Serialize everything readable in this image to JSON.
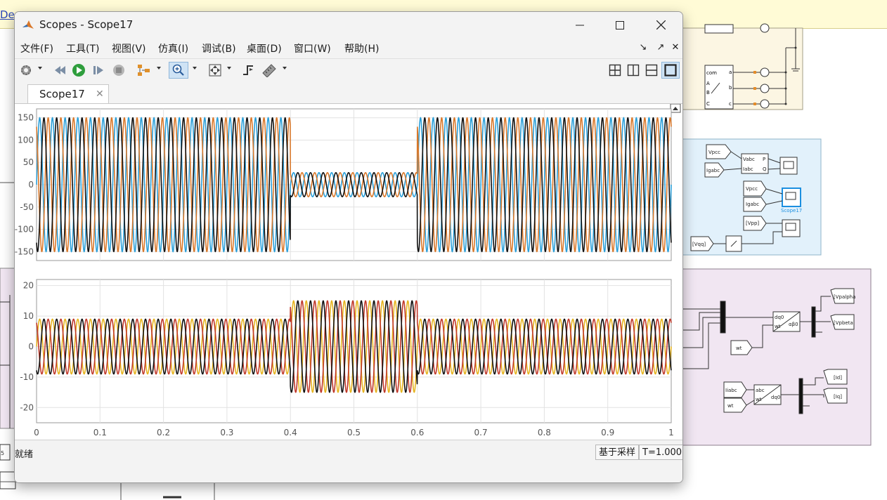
{
  "background": {
    "link_text": "De",
    "scope_block_label": "Scope17",
    "labels": {
      "vpcc1": "Vpcc",
      "igabc1": "Igabc",
      "vabc": "Vabc",
      "iabc": "Iabc",
      "p": "P",
      "q": "Q",
      "vpcc2": "Vpcc",
      "igabc2": "Igabc",
      "vpp": "[Vpp]",
      "vqq": "[Vqq]",
      "vpalpha": "[Vpalpha",
      "vpbeta": "[Vpbeta",
      "wt1": "wt",
      "dq0": "dq0",
      "wt2": "wt",
      "ab0": "αβ0",
      "id": "[Id]",
      "iq": "[Iq]",
      "iiabc": "Iiabc",
      "wt3": "wt",
      "abc": "abc",
      "wt4": "wt",
      "dq02": "dq0",
      "com": "com",
      "a_in": "A",
      "b_in": "B",
      "c_in": "C",
      "a_out": "a",
      "b_out": "b",
      "c_out": "c",
      "side5": "5"
    }
  },
  "window": {
    "title": "Scopes - Scope17",
    "menus": [
      "文件(F)",
      "工具(T)",
      "视图(V)",
      "仿真(I)",
      "调试(B)",
      "桌面(D)",
      "窗口(W)",
      "帮助(H)"
    ],
    "tab_label": "Scope17",
    "status": "就绪",
    "sample_mode": "基于采样",
    "time_readout": "T=1.000"
  },
  "colors": {
    "black": "#111111",
    "orange": "#d9782a",
    "blue": "#2b9fd8",
    "yellow": "#e6b420",
    "dark_orange": "#c0392b"
  },
  "chart_data": [
    {
      "type": "line",
      "title": "",
      "xlim": [
        0,
        1
      ],
      "ylim": [
        -170,
        170
      ],
      "yticks": [
        -150,
        -100,
        -50,
        0,
        50,
        100,
        150
      ],
      "xticks": [],
      "grid": true,
      "series": [
        {
          "color": "blue",
          "phase": 0,
          "amp_segments": [
            [
              0,
              0.4,
              150
            ],
            [
              0.4,
              0.6,
              27
            ],
            [
              0.6,
              1,
              150
            ]
          ]
        },
        {
          "color": "orange",
          "phase": 120,
          "amp_segments": [
            [
              0,
              0.4,
              150
            ],
            [
              0.4,
              0.6,
              27
            ],
            [
              0.6,
              1,
              150
            ]
          ]
        },
        {
          "color": "black",
          "phase": 240,
          "amp_segments": [
            [
              0,
              0.4,
              150
            ],
            [
              0.4,
              0.6,
              27
            ],
            [
              0.6,
              1,
              150
            ]
          ]
        }
      ],
      "frequency_hz": 50
    },
    {
      "type": "line",
      "title": "",
      "xlim": [
        0,
        1
      ],
      "ylim": [
        -25,
        22
      ],
      "yticks": [
        -20,
        -10,
        0,
        10,
        20
      ],
      "xticks": [
        0,
        0.1,
        0.2,
        0.3,
        0.4,
        0.5,
        0.6,
        0.7,
        0.8,
        0.9,
        1
      ],
      "grid": true,
      "series": [
        {
          "color": "yellow",
          "phase": 0,
          "amp_segments": [
            [
              0,
              0.4,
              9
            ],
            [
              0.4,
              0.6,
              15
            ],
            [
              0.6,
              1,
              9
            ]
          ]
        },
        {
          "color": "dark_orange",
          "phase": 120,
          "amp_segments": [
            [
              0,
              0.4,
              9
            ],
            [
              0.4,
              0.6,
              15
            ],
            [
              0.6,
              1,
              9
            ]
          ]
        },
        {
          "color": "black",
          "phase": 240,
          "amp_segments": [
            [
              0,
              0.4,
              9
            ],
            [
              0.4,
              0.6,
              15
            ],
            [
              0.6,
              1,
              9
            ]
          ]
        }
      ],
      "frequency_hz": 50
    }
  ]
}
